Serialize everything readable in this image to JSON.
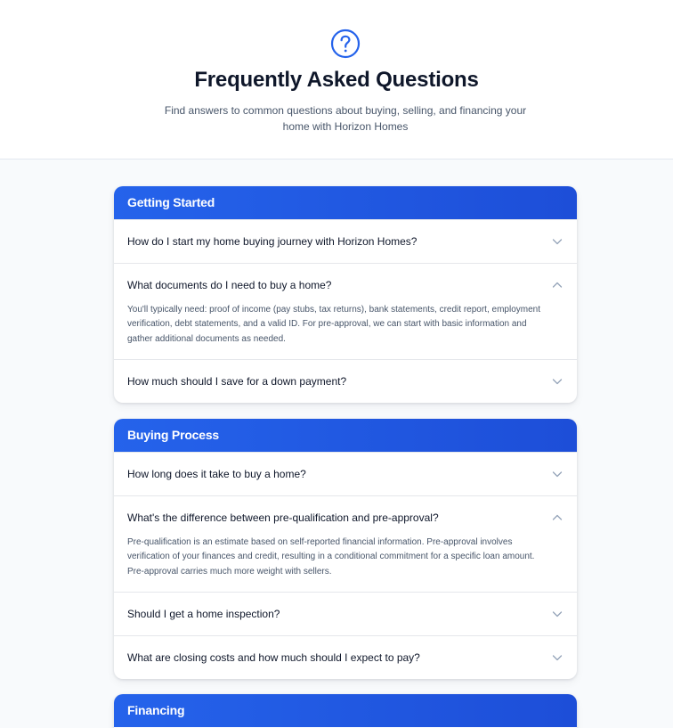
{
  "hero": {
    "title": "Frequently Asked Questions",
    "subtitle": "Find answers to common questions about buying, selling, and financing your home with Horizon Homes",
    "icon": "question-circle-icon"
  },
  "colors": {
    "accent": "#2563eb",
    "header_gradient_end": "#1d4ed8"
  },
  "sections": [
    {
      "title": "Getting Started",
      "items": [
        {
          "question": "How do I start my home buying journey with Horizon Homes?",
          "expanded": false,
          "answer": ""
        },
        {
          "question": "What documents do I need to buy a home?",
          "expanded": true,
          "answer": "You'll typically need: proof of income (pay stubs, tax returns), bank statements, credit report, employment verification, debt statements, and a valid ID. For pre-approval, we can start with basic information and gather additional documents as needed."
        },
        {
          "question": "How much should I save for a down payment?",
          "expanded": false,
          "answer": ""
        }
      ]
    },
    {
      "title": "Buying Process",
      "items": [
        {
          "question": "How long does it take to buy a home?",
          "expanded": false,
          "answer": ""
        },
        {
          "question": "What's the difference between pre-qualification and pre-approval?",
          "expanded": true,
          "answer": "Pre-qualification is an estimate based on self-reported financial information. Pre-approval involves verification of your finances and credit, resulting in a conditional commitment for a specific loan amount. Pre-approval carries much more weight with sellers."
        },
        {
          "question": "Should I get a home inspection?",
          "expanded": false,
          "answer": ""
        },
        {
          "question": "What are closing costs and how much should I expect to pay?",
          "expanded": false,
          "answer": ""
        }
      ]
    },
    {
      "title": "Financing",
      "items": []
    }
  ]
}
